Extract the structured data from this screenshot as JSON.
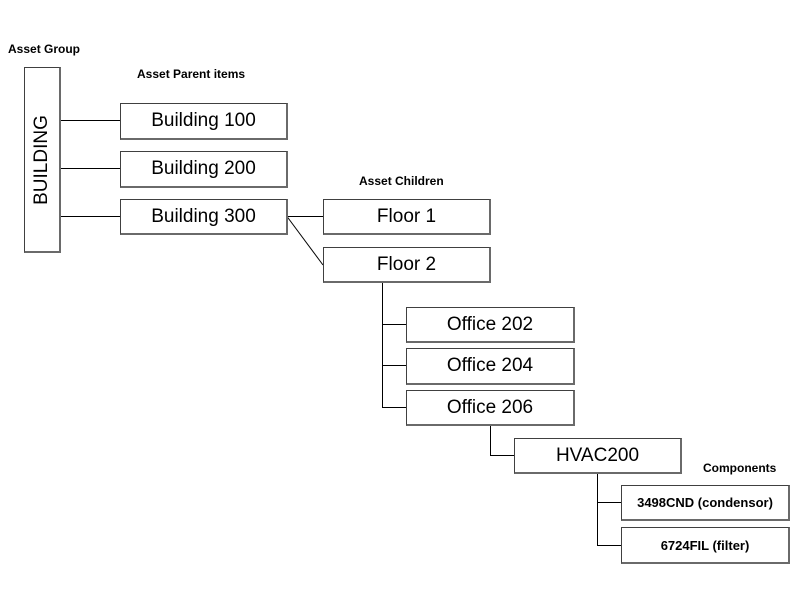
{
  "diagram": {
    "section_labels": {
      "asset_group": "Asset Group",
      "asset_parent_items": "Asset Parent items",
      "asset_children": "Asset Children",
      "components": "Components"
    },
    "asset_group": {
      "label": "BUILDING"
    },
    "parents": [
      {
        "label": "Building 100"
      },
      {
        "label": "Building 200"
      },
      {
        "label": "Building 300"
      }
    ],
    "children": [
      {
        "label": "Floor 1",
        "parent": "Building 300"
      },
      {
        "label": "Floor 2",
        "parent": "Building 300"
      }
    ],
    "offices": [
      {
        "label": "Office 202",
        "parent": "Floor 2"
      },
      {
        "label": "Office 204",
        "parent": "Floor 2"
      },
      {
        "label": "Office 206",
        "parent": "Floor 2"
      }
    ],
    "equipment": {
      "label": "HVAC200",
      "parent": "Office 206"
    },
    "components": [
      {
        "label": "3498CND (condensor)",
        "parent": "HVAC200"
      },
      {
        "label": "6724FIL (filter)",
        "parent": "HVAC200"
      }
    ]
  }
}
